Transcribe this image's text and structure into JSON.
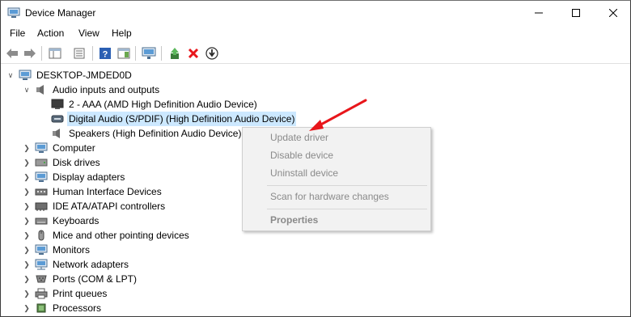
{
  "window": {
    "title": "Device Manager"
  },
  "menu": [
    "File",
    "Action",
    "View",
    "Help"
  ],
  "tree": {
    "root": "DESKTOP-JMDED0D",
    "audio_group": "Audio inputs and outputs",
    "audio_children": [
      "2 - AAA (AMD High Definition Audio Device)",
      "Digital Audio (S/PDIF) (High Definition Audio Device)",
      "Speakers (High Definition Audio Device)"
    ],
    "categories": [
      "Computer",
      "Disk drives",
      "Display adapters",
      "Human Interface Devices",
      "IDE ATA/ATAPI controllers",
      "Keyboards",
      "Mice and other pointing devices",
      "Monitors",
      "Network adapters",
      "Ports (COM & LPT)",
      "Print queues",
      "Processors"
    ]
  },
  "context_menu": {
    "update": "Update driver",
    "disable": "Disable device",
    "uninstall": "Uninstall device",
    "scan": "Scan for hardware changes",
    "properties": "Properties"
  },
  "colors": {
    "selection": "#cce8ff",
    "arrow": "#e8161b",
    "disabled_text": "#8a8a8a"
  }
}
